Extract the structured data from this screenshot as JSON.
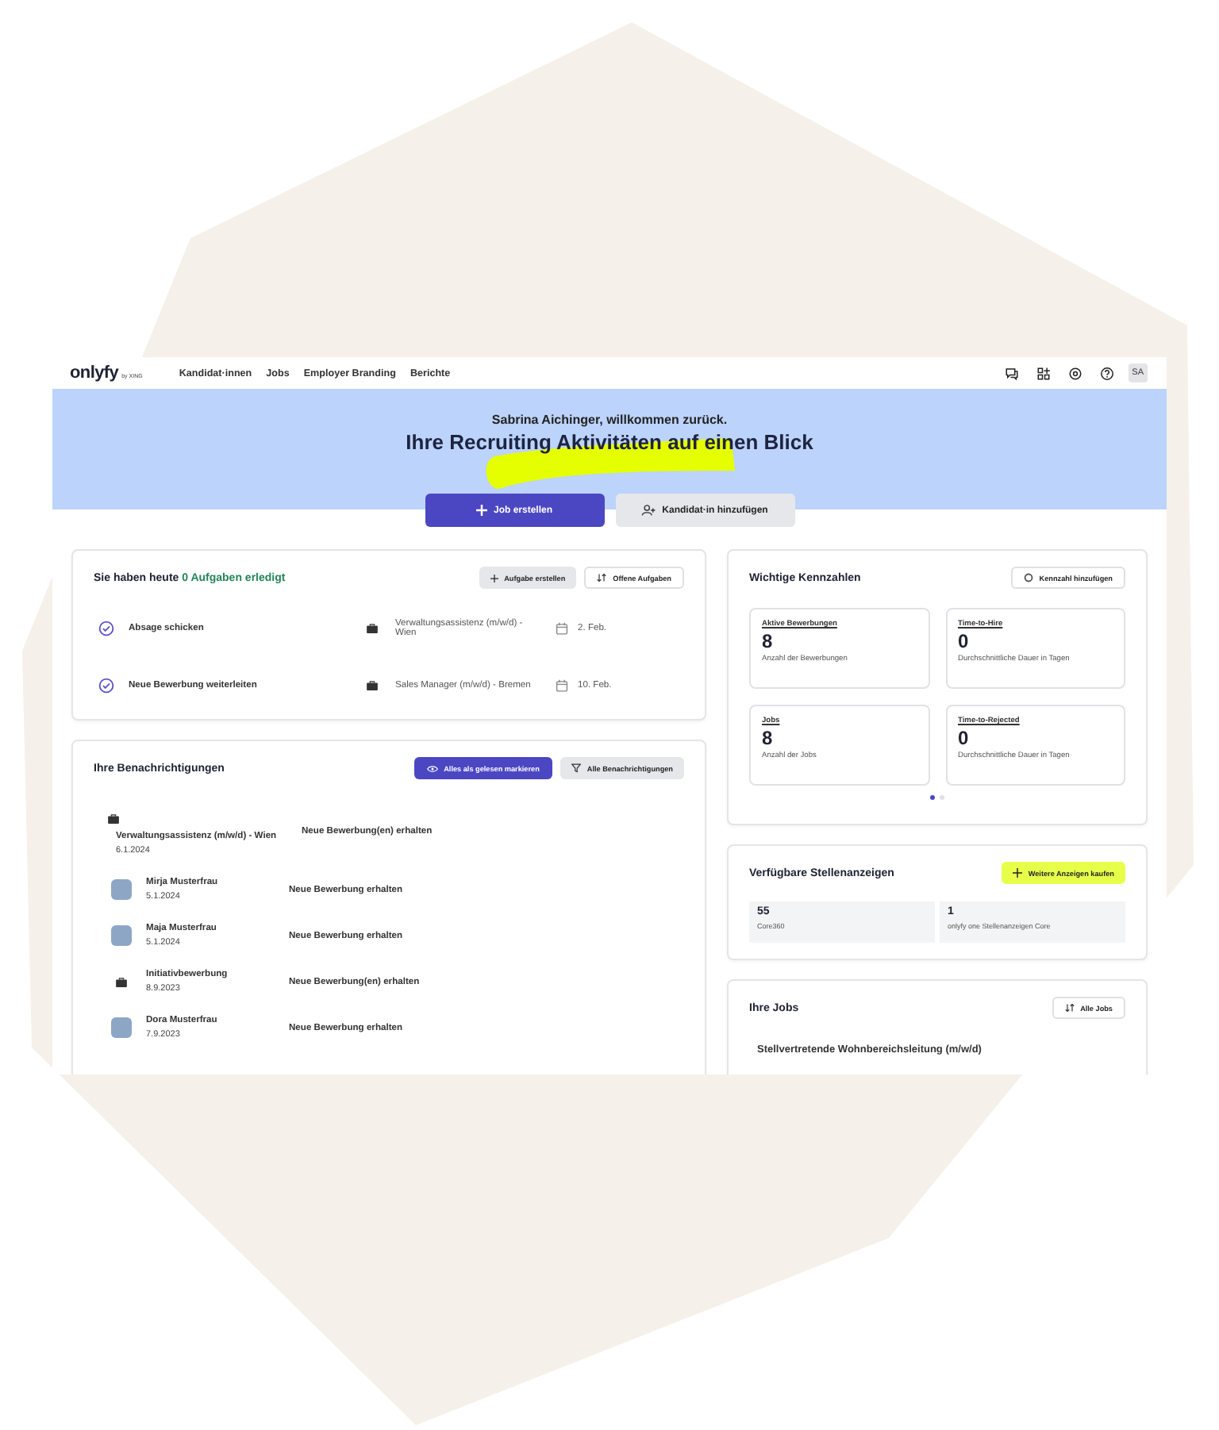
{
  "nav": {
    "logo": "onlyfy",
    "logo_sub": "by XING",
    "items": [
      "Kandidat·innen",
      "Jobs",
      "Employer Branding",
      "Berichte"
    ],
    "avatar": "SA"
  },
  "hero": {
    "greeting": "Sabrina Aichinger, willkommen zurück.",
    "headline": "Ihre Recruiting Aktivitäten auf einen Blick",
    "primary_button": "Job erstellen",
    "secondary_button": "Kandidat·in hinzufügen"
  },
  "tasks": {
    "title_prefix": "Sie haben heute",
    "title_count": "0 Aufgaben erledigt",
    "buttons": [
      "Aufgabe erstellen",
      "Offene Aufgaben"
    ],
    "items": [
      {
        "title": "Absage schicken",
        "job": "Verwaltungsassistenz (m/w/d) - Wien",
        "date": "2. Feb."
      },
      {
        "title": "Neue Bewerbung weiterleiten",
        "job": "Sales Manager (m/w/d) - Bremen",
        "date": "10. Feb."
      }
    ]
  },
  "notifications": {
    "title": "Ihre Benachrichtigungen",
    "buttons": [
      "Alles als gelesen markieren",
      "Alle Benachrichtigungen"
    ],
    "items": [
      {
        "kind": "job-wide",
        "title": "Verwaltungsassistenz (m/w/d) - Wien",
        "date": "6.1.2024",
        "message": "Neue Bewerbung(en) erhalten"
      },
      {
        "kind": "person",
        "title": "Mirja Musterfrau",
        "date": "5.1.2024",
        "message": "Neue Bewerbung erhalten"
      },
      {
        "kind": "person",
        "title": "Maja Musterfrau",
        "date": "5.1.2024",
        "message": "Neue Bewerbung erhalten"
      },
      {
        "kind": "job",
        "title": "Initiativbewerbung",
        "date": "8.9.2023",
        "message": "Neue Bewerbung(en) erhalten"
      },
      {
        "kind": "person",
        "title": "Dora Musterfrau",
        "date": "7.9.2023",
        "message": "Neue Bewerbung erhalten"
      }
    ]
  },
  "kpis": {
    "title": "Wichtige Kennzahlen",
    "button": "Kennzahl hinzufügen",
    "cards": [
      {
        "label": "Aktive Bewerbungen",
        "value": "8",
        "caption": "Anzahl der Bewerbungen"
      },
      {
        "label": "Time-to-Hire",
        "value": "0",
        "caption": "Durchschnittliche Dauer in Tagen"
      },
      {
        "label": "Jobs",
        "value": "8",
        "caption": "Anzahl der Jobs"
      },
      {
        "label": "Time-to-Rejected",
        "value": "0",
        "caption": "Durchschnittliche Dauer in Tagen"
      }
    ],
    "pages": [
      {
        "selected": true
      },
      {
        "selected": false
      }
    ]
  },
  "ads": {
    "title": "Verfügbare Stellenanzeigen",
    "button": "Weitere Anzeigen kaufen",
    "items": [
      {
        "value": "55",
        "label": "Core360"
      },
      {
        "value": "1",
        "label": "onlyfy one Stellenanzeigen Core"
      }
    ]
  },
  "jobs": {
    "title": "Ihre Jobs",
    "button": "Alle Jobs",
    "items": [
      "Stellvertretende Wohnbereichsleitung (m/w/d)"
    ]
  }
}
